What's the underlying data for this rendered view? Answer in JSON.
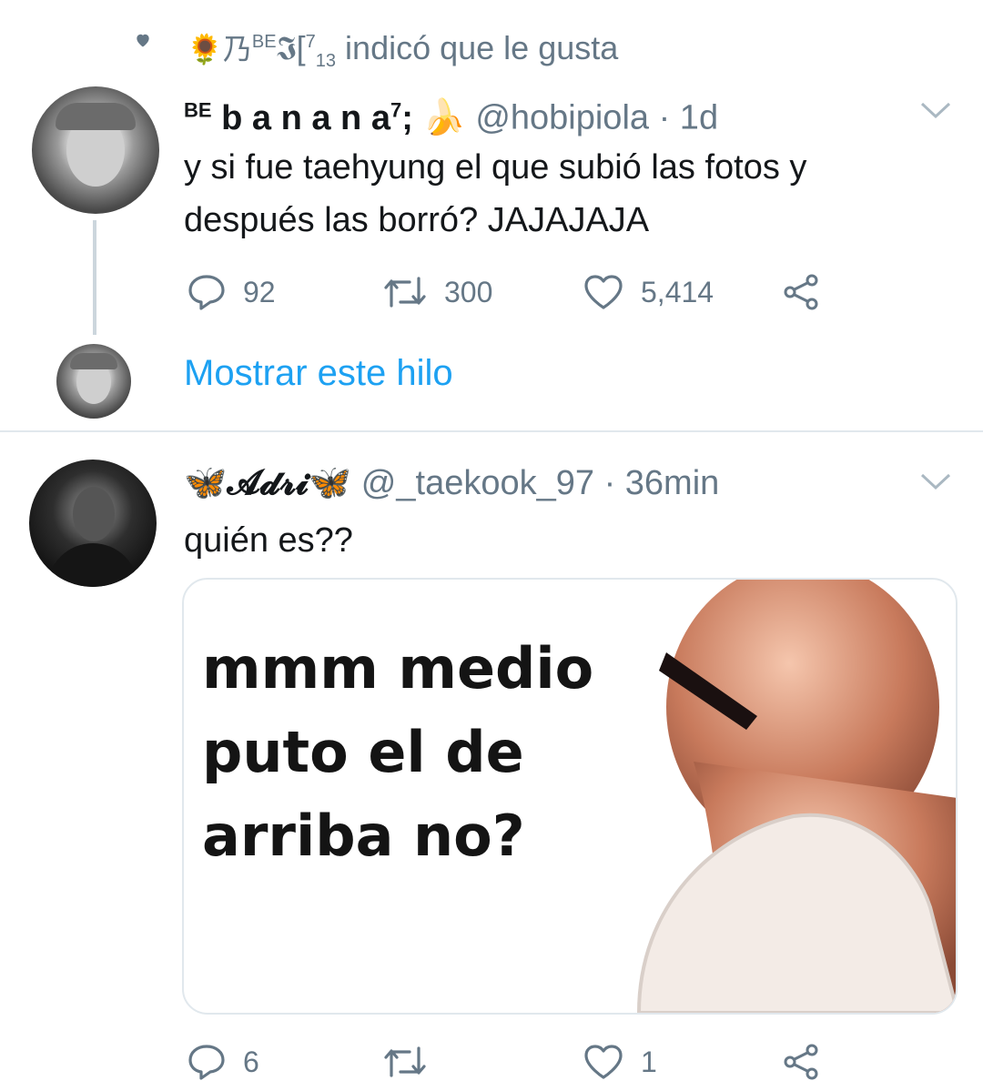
{
  "liked_by": {
    "name_prefix": "🌻乃",
    "name_sup": "BE",
    "name_suffix": "𝕴[",
    "name_sup2": "7",
    "name_sub": "13",
    "action": "indicó que le gusta"
  },
  "tweet1": {
    "name_sup": "BE",
    "name": "b a n a n a",
    "name_sup2": "7",
    "name_tail": ";",
    "emoji": "🍌",
    "handle": "@hobipiola",
    "time": "· 1d",
    "text_line1": "y si fue taehyung el que subió las fotos y",
    "text_line2": "después las borró? JAJAJAJA",
    "replies": "92",
    "retweets": "300",
    "likes": "5,414"
  },
  "show_thread": "Mostrar este hilo",
  "tweet2": {
    "name_emoji_left": "🦋",
    "name": "𝓐𝓭𝓻𝓲",
    "name_emoji_right": "🦋",
    "handle": "@_taekook_97",
    "time": "· 36min",
    "text": "quién es??",
    "media_text_line1": "mmm medio",
    "media_text_line2": "puto el de",
    "media_text_line3": "arriba no?",
    "replies": "6",
    "retweets": "",
    "likes": "1"
  },
  "colors": {
    "accent": "#1da1f2",
    "secondary_text": "#657786",
    "divider": "#e1e8ed"
  },
  "icons": [
    "heart-icon",
    "chevron-down-icon",
    "reply-icon",
    "retweet-icon",
    "like-icon",
    "share-icon"
  ]
}
